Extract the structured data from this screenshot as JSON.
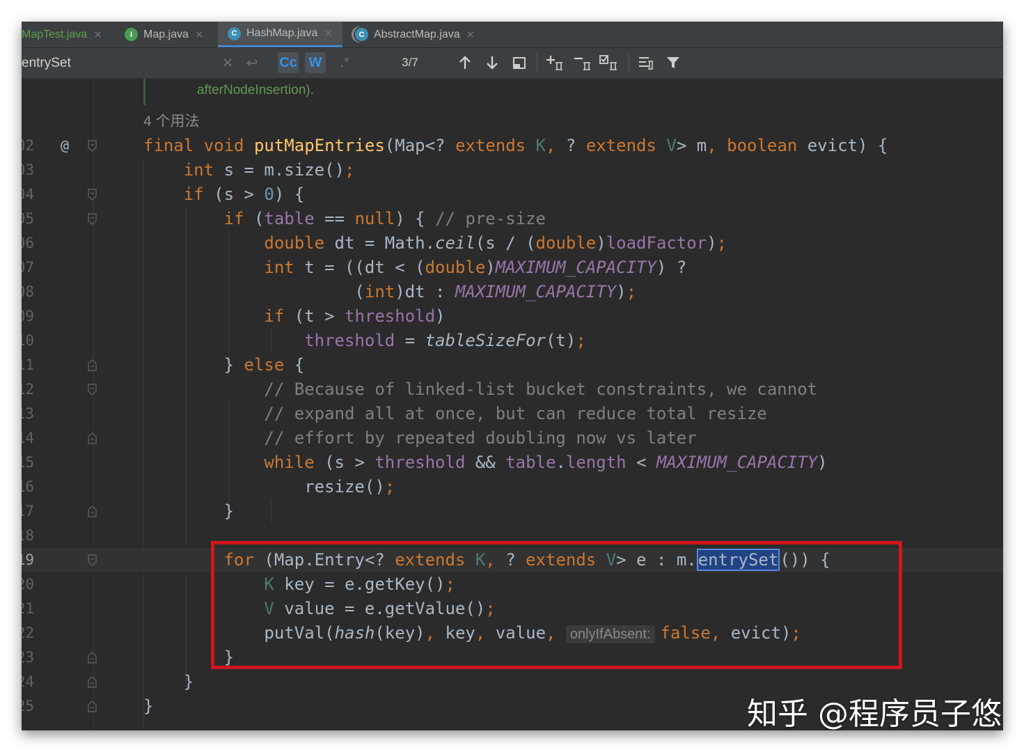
{
  "tabs": [
    {
      "label": "MapTest.java",
      "icon": "java-file-icon",
      "active": false,
      "color": "#499c54"
    },
    {
      "label": "Map.java",
      "icon": "interface-icon",
      "icon_glyph": "I",
      "active": false,
      "color": "#499c54"
    },
    {
      "label": "HashMap.java",
      "icon": "class-icon",
      "icon_glyph": "C",
      "active": true,
      "color": "#3d8eb3"
    },
    {
      "label": "AbstractMap.java",
      "icon": "abstract-class-icon",
      "icon_glyph": "C",
      "active": false,
      "color": "#3d8eb3"
    }
  ],
  "find_bar": {
    "query": "entrySet",
    "match_case_label": "Cc",
    "whole_words_label": "W",
    "regex_label": ".*",
    "match_count": "3/7"
  },
  "editor": {
    "doc_fragment": "afterNodeInsertion).",
    "usages_hint": "4 个用法",
    "inlay_hint": "onlyIfAbsent:",
    "gutter_annotation": "@",
    "line_numbers": [
      "02",
      "03",
      "04",
      "05",
      "06",
      "07",
      "08",
      "09",
      "10",
      "11",
      "12",
      "13",
      "14",
      "15",
      "16",
      "17",
      "18",
      "19",
      "20",
      "21",
      "22",
      "23",
      "24",
      "25"
    ]
  },
  "highlight_color": "#d0161e",
  "watermark": "知乎 @程序员子悠"
}
